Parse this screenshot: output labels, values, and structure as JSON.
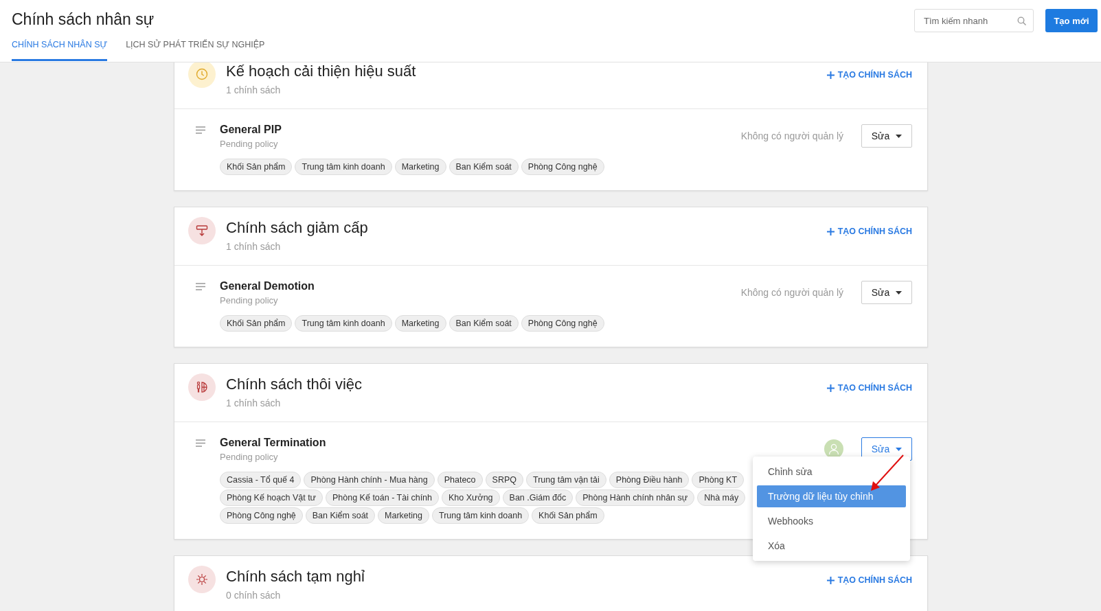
{
  "header": {
    "title": "Chính sách nhân sự",
    "tabs": [
      {
        "label": "CHÍNH SÁCH NHÂN SỰ",
        "selected": true
      },
      {
        "label": "LỊCH SỬ PHÁT TRIỂN SỰ NGHIỆP",
        "selected": false
      }
    ],
    "search": {
      "placeholder": "Tìm kiếm nhanh"
    },
    "create_button": "Tạo mới"
  },
  "sections": [
    {
      "title": "Kế hoạch cải thiện hiệu suất",
      "count": "1 chính sách",
      "add_label": "TẠO CHÍNH SÁCH",
      "policies": [
        {
          "name": "General PIP",
          "status": "Pending policy",
          "manager": "Không có người quản lý",
          "button": "Sửa",
          "menu_open": false,
          "tag_rows": [
            [
              "Khối Sản phẩm",
              "Trung tâm kinh doanh",
              "Marketing",
              "Ban Kiểm soát",
              "Phòng Công nghệ"
            ]
          ]
        }
      ]
    },
    {
      "title": "Chính sách giảm cấp",
      "count": "1 chính sách",
      "add_label": "TẠO CHÍNH SÁCH",
      "policies": [
        {
          "name": "General Demotion",
          "status": "Pending policy",
          "manager": "Không có người quản lý",
          "button": "Sửa",
          "menu_open": false,
          "tag_rows": [
            [
              "Khối Sản phẩm",
              "Trung tâm kinh doanh",
              "Marketing",
              "Ban Kiểm soát",
              "Phòng Công nghệ"
            ]
          ]
        }
      ]
    },
    {
      "title": "Chính sách thôi việc",
      "count": "1 chính sách",
      "add_label": "TẠO CHÍNH SÁCH",
      "policies": [
        {
          "name": "General Termination",
          "status": "Pending policy",
          "button": "Sửa",
          "menu_open": true,
          "menu": [
            {
              "label": "Chỉnh sửa",
              "selected": false
            },
            {
              "label": "Trường dữ liệu tùy chỉnh",
              "selected": true
            },
            {
              "label": "Webhooks",
              "selected": false
            },
            {
              "label": "Xóa",
              "selected": false
            }
          ],
          "tag_rows": [
            [
              "Cassia - Tổ quế 4",
              "Phòng Hành chính - Mua hàng",
              "Phateco",
              "SRPQ",
              "Trung tâm vận tải",
              "Phòng Điều hành",
              "Phòng KT"
            ],
            [
              "Phòng Kế hoạch Vật tư",
              "Phòng Kế toán - Tài chính",
              "Kho Xưởng",
              "Ban .Giám đốc",
              "Phòng Hành chính nhân sự",
              "Nhà máy"
            ],
            [
              "Phòng Công nghệ",
              "Ban Kiểm soát",
              "Marketing",
              "Trung tâm kinh doanh",
              "Khối Sản phẩm"
            ]
          ]
        }
      ]
    },
    {
      "title": "Chính sách tạm nghỉ",
      "count": "0 chính sách",
      "add_label": "TẠO CHÍNH SÁCH"
    }
  ]
}
